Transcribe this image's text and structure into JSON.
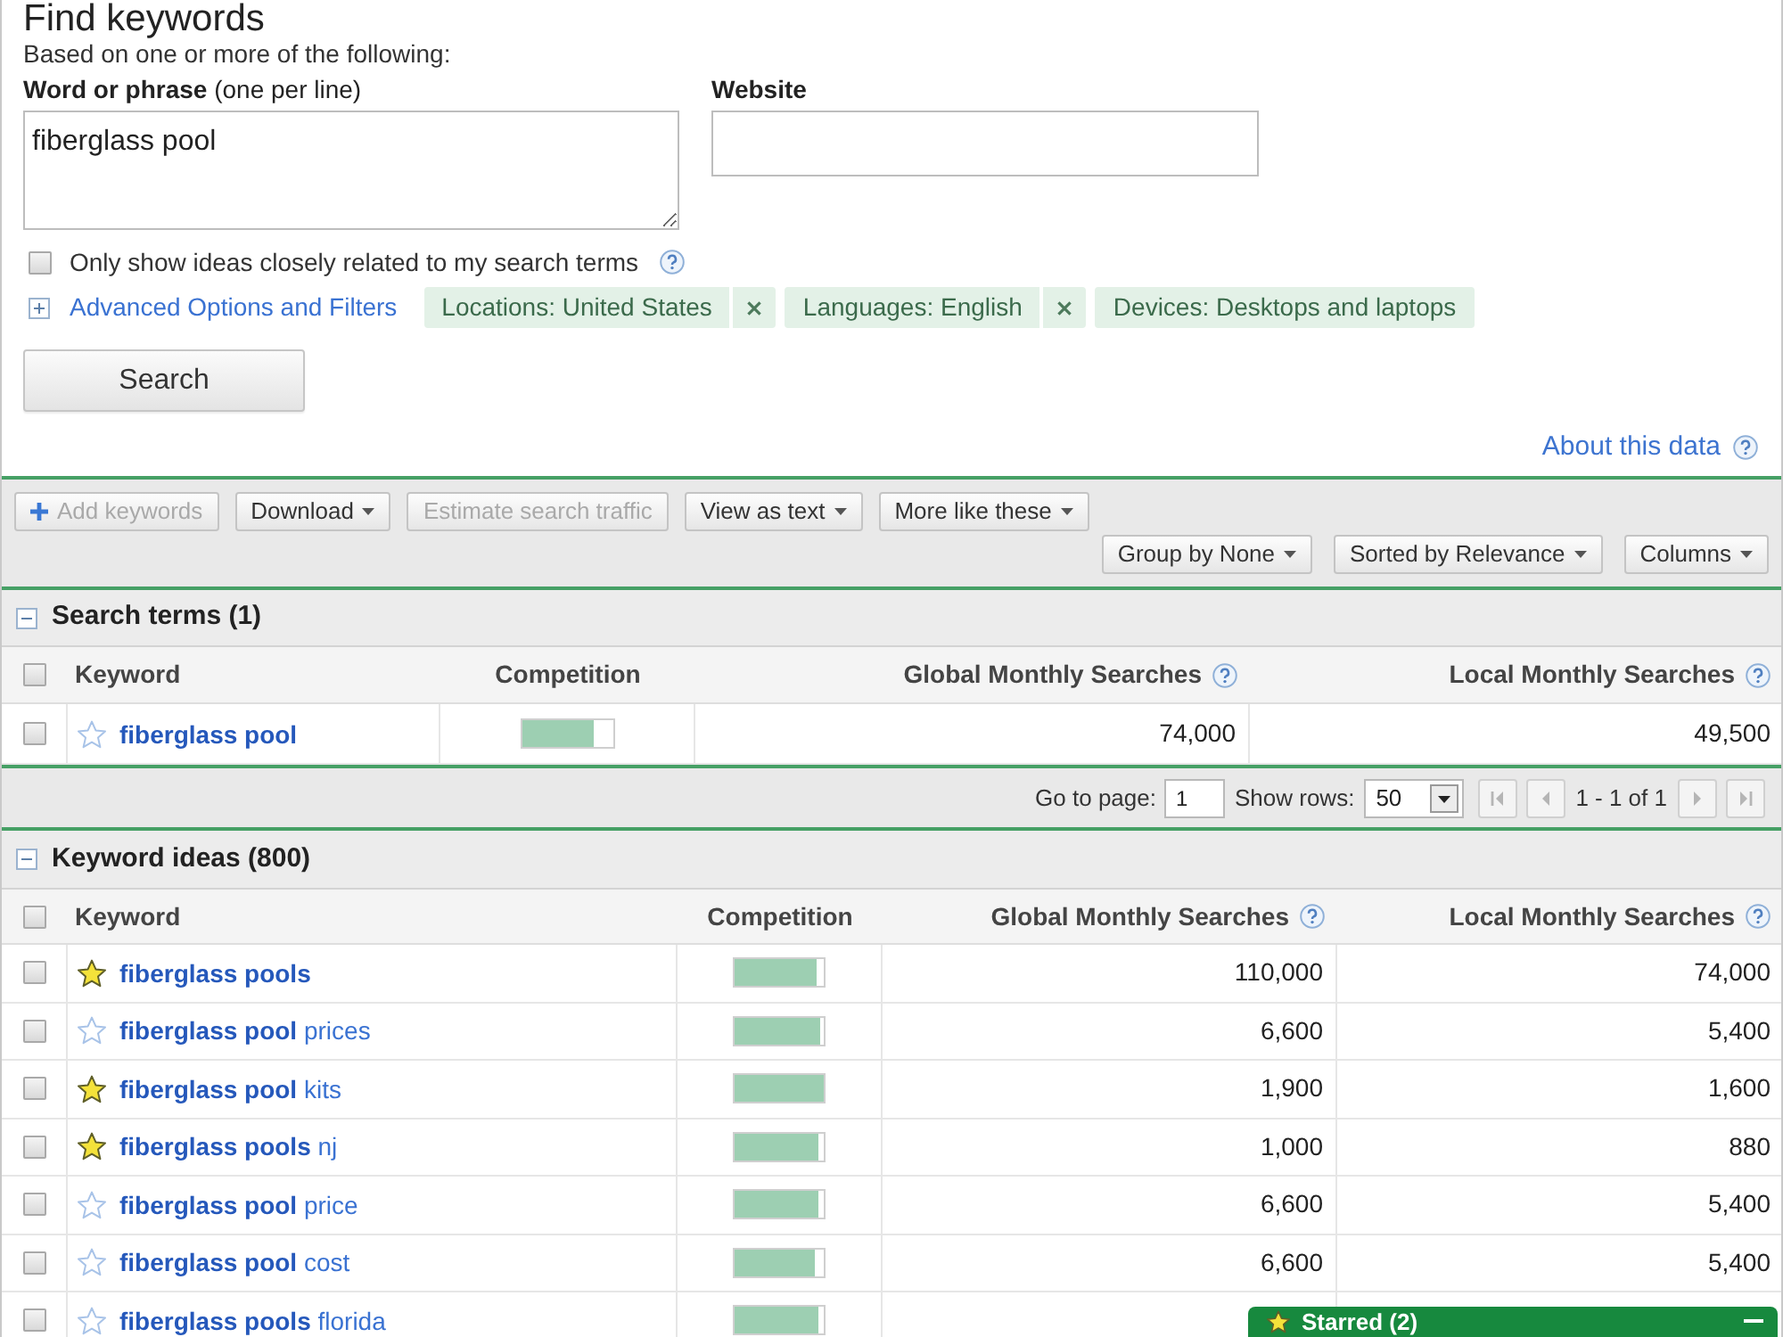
{
  "header": {
    "title": "Find keywords",
    "subtitle": "Based on one or more of the following:"
  },
  "form": {
    "phrase": {
      "label": "**Word or phrase** (one per line)",
      "value": "fiberglass pool"
    },
    "website": {
      "label": "Website"
    },
    "close_match": {
      "label": "Only show ideas closely related to my search terms",
      "checked": false,
      "help": true
    },
    "advanced": {
      "label": "Advanced Options and Filters",
      "expanded": false
    },
    "filters": [
      {
        "label": "Locations: United States",
        "removable": true
      },
      {
        "label": "Languages: English",
        "removable": true
      },
      {
        "label": "Devices: Desktops and laptops",
        "removable": false
      }
    ],
    "search_button": "Search"
  },
  "about_link": "About this data",
  "toolbar": {
    "buttons": [
      {
        "label": "Add keywords",
        "kind": "add",
        "disabled": true
      },
      {
        "label": "Download",
        "kind": "menu",
        "disabled": false
      },
      {
        "label": "Estimate search traffic",
        "kind": "plain",
        "disabled": true
      },
      {
        "label": "View as text",
        "kind": "menu",
        "disabled": false
      },
      {
        "label": "More like these",
        "kind": "menu",
        "disabled": false
      }
    ],
    "view_buttons": [
      {
        "label": "Group by None",
        "kind": "menu"
      },
      {
        "label": "Sorted by Relevance",
        "kind": "menu"
      },
      {
        "label": "Columns",
        "kind": "menu"
      }
    ]
  },
  "search_terms": {
    "title": "Search terms (1)",
    "expanded": true,
    "all_checked": false,
    "columns": [
      {
        "label": "Keyword",
        "help": false
      },
      {
        "label": "Competition",
        "help": false
      },
      {
        "label": "Global Monthly Searches",
        "help": true
      },
      {
        "label": "Local Monthly Searches",
        "help": true
      }
    ],
    "rows": [
      {
        "checked": false,
        "starred": false,
        "keyword": {
          "match": "fiberglass pool"
        },
        "competition": {
          "level": 0.8
        },
        "global": "74,000",
        "local": "49,500"
      }
    ]
  },
  "pager": {
    "goto_label": "Go to page:",
    "page": "1",
    "rows_label": "Show rows:",
    "rows_value": "50",
    "nav": [
      {
        "kind": "first",
        "disabled": true
      },
      {
        "kind": "prev",
        "disabled": true
      },
      {
        "kind": "next",
        "disabled": true
      },
      {
        "kind": "last",
        "disabled": true
      }
    ],
    "range": "1 - 1 of 1"
  },
  "keyword_ideas": {
    "title": "Keyword ideas (800)",
    "expanded": true,
    "all_checked": false,
    "columns": [
      {
        "label": "Keyword",
        "help": false
      },
      {
        "label": "Competition",
        "help": false
      },
      {
        "label": "Global Monthly Searches",
        "help": true
      },
      {
        "label": "Local Monthly Searches",
        "help": true
      }
    ],
    "rows": [
      {
        "checked": false,
        "starred": true,
        "keyword": {
          "match": "fiberglass pools"
        },
        "competition": {
          "level": 0.92
        },
        "global": "110,000",
        "local": "74,000"
      },
      {
        "checked": false,
        "starred": false,
        "keyword": {
          "match": "fiberglass pool",
          "rest": "prices"
        },
        "competition": {
          "level": 0.96
        },
        "global": "6,600",
        "local": "5,400"
      },
      {
        "checked": false,
        "starred": true,
        "keyword": {
          "match": "fiberglass pool",
          "rest": "kits"
        },
        "competition": {
          "level": 1
        },
        "global": "1,900",
        "local": "1,600"
      },
      {
        "checked": false,
        "starred": true,
        "keyword": {
          "match": "fiberglass pools",
          "rest": "nj"
        },
        "competition": {
          "level": 0.94
        },
        "global": "1,000",
        "local": "880"
      },
      {
        "checked": false,
        "starred": false,
        "keyword": {
          "match": "fiberglass pool",
          "rest": "price"
        },
        "competition": {
          "level": 0.94
        },
        "global": "6,600",
        "local": "5,400"
      },
      {
        "checked": false,
        "starred": false,
        "keyword": {
          "match": "fiberglass pool",
          "rest": "cost"
        },
        "competition": {
          "level": 0.9
        },
        "global": "6,600",
        "local": "5,400"
      },
      {
        "checked": false,
        "starred": false,
        "keyword": {
          "match": "fiberglass pools",
          "rest": "florida"
        },
        "competition": {
          "level": 0.94
        }
      }
    ]
  },
  "starred_panel": {
    "title": "Starred (2)",
    "expanded": true
  }
}
